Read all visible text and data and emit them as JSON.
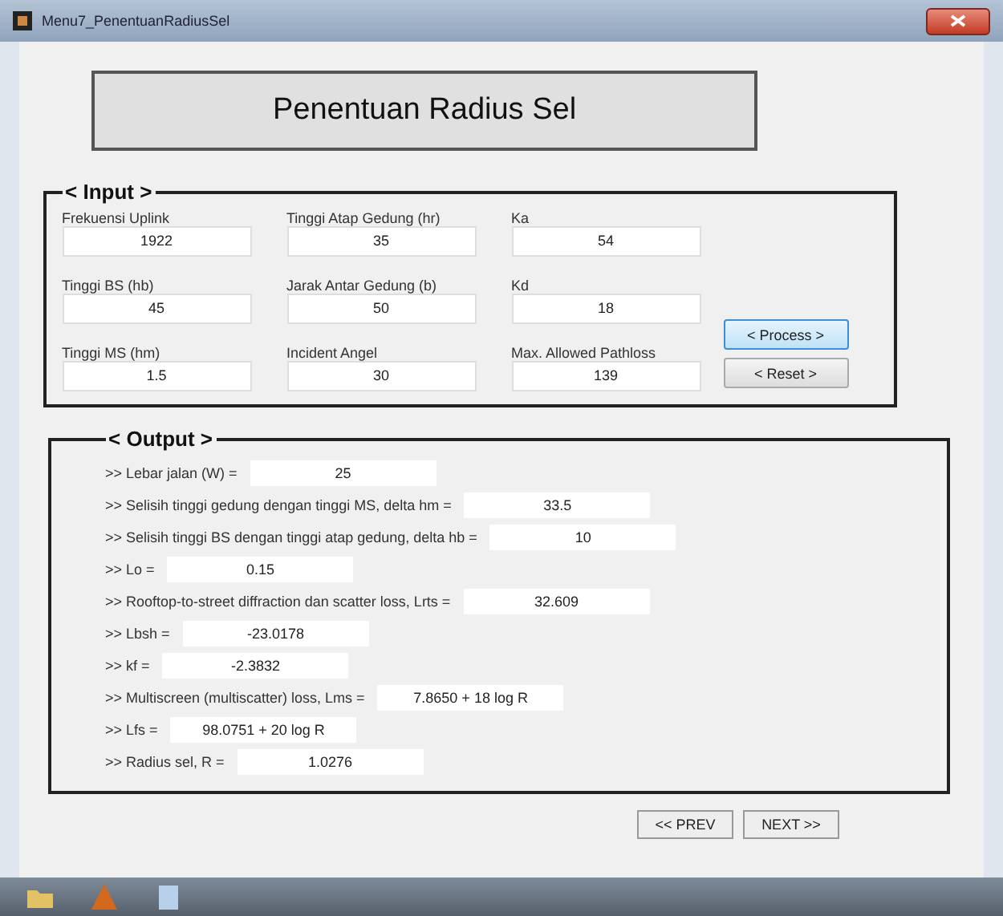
{
  "window": {
    "title": "Menu7_PenentuanRadiusSel"
  },
  "header": "Penentuan Radius Sel",
  "input": {
    "title": "< Input >",
    "fields": [
      {
        "label": "Frekuensi Uplink",
        "value": "1922"
      },
      {
        "label": "Tinggi Atap Gedung (hr)",
        "value": "35"
      },
      {
        "label": "Ka",
        "value": "54"
      },
      {
        "label": "Tinggi BS (hb)",
        "value": "45"
      },
      {
        "label": "Jarak Antar Gedung (b)",
        "value": "50"
      },
      {
        "label": "Kd",
        "value": "18"
      },
      {
        "label": "Tinggi MS (hm)",
        "value": "1.5"
      },
      {
        "label": "Incident Angel",
        "value": "30"
      },
      {
        "label": "Max. Allowed Pathloss",
        "value": "139"
      }
    ],
    "buttons": [
      {
        "label": "< Process >",
        "selected": true
      },
      {
        "label": "< Reset >",
        "selected": false
      }
    ]
  },
  "output": {
    "title": "< Output >",
    "rows": [
      {
        "label": ">> Lebar jalan (W) =",
        "value": "25"
      },
      {
        "label": ">> Selisih tinggi gedung dengan tinggi MS, delta hm =",
        "value": "33.5"
      },
      {
        "label": ">> Selisih tinggi BS dengan tinggi atap gedung, delta hb =",
        "value": "10"
      },
      {
        "label": ">> Lo =",
        "value": "0.15"
      },
      {
        "label": ">> Rooftop-to-street diffraction dan scatter loss, Lrts =",
        "value": "32.609"
      },
      {
        "label": ">> Lbsh =",
        "value": "-23.0178"
      },
      {
        "label": ">> kf =",
        "value": "-2.3832"
      },
      {
        "label": ">> Multiscreen (multiscatter) loss, Lms =",
        "value": "7.8650  +  18  log R"
      },
      {
        "label": ">> Lfs =",
        "value": "98.0751  + 20 log R"
      },
      {
        "label": ">> Radius sel, R =",
        "value": "1.0276"
      }
    ]
  },
  "nav_buttons": [
    "<< PREV",
    "NEXT >>"
  ]
}
